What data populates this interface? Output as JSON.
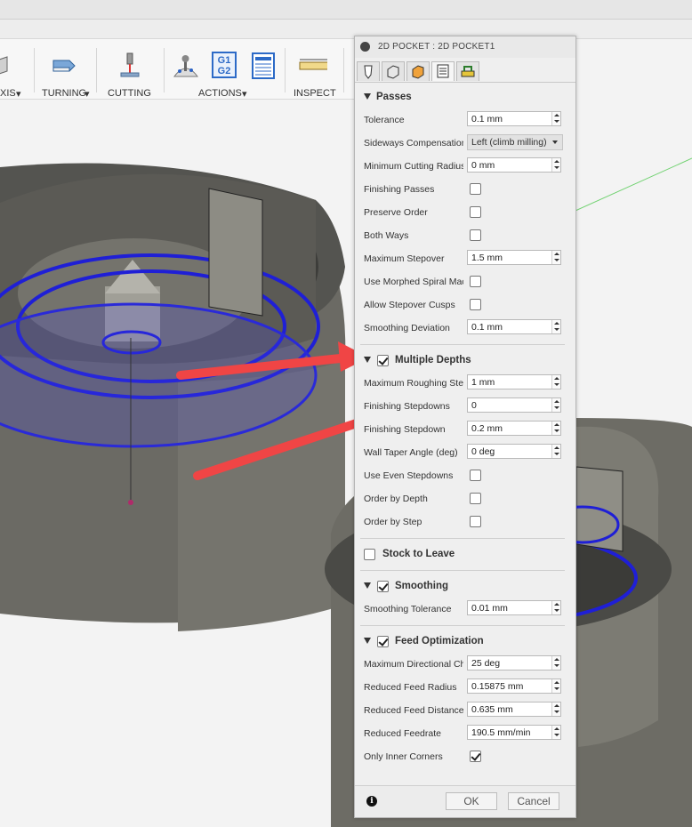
{
  "toolbar": {
    "axis_label": "XIS",
    "turning_label": "TURNING",
    "cutting_label": "CUTTING",
    "actions_label": "ACTIONS",
    "inspect_label": "INSPECT",
    "g1g2_top": "G1",
    "g1g2_bottom": "G2",
    "icons": [
      "axis-icon",
      "turning-icon",
      "cutting-icon",
      "actions-simulate-icon",
      "g1g2-icon",
      "setup-sheet-icon",
      "measure-icon"
    ]
  },
  "panel": {
    "title": "2D POCKET : 2D POCKET1",
    "tabs": [
      "tool-tab",
      "geometry-tab",
      "heights-tab",
      "passes-tab",
      "linking-tab"
    ],
    "active_tab": "passes-tab",
    "passes": {
      "title": "Passes",
      "tolerance_label": "Tolerance",
      "tolerance_value": "0.1 mm",
      "sideways_label": "Sideways Compensation",
      "sideways_value": "Left (climb milling)",
      "min_radius_label": "Minimum Cutting Radius",
      "min_radius_value": "0 mm",
      "finishing_passes_label": "Finishing Passes",
      "finishing_passes_checked": false,
      "preserve_order_label": "Preserve Order",
      "preserve_order_checked": false,
      "both_ways_label": "Both Ways",
      "both_ways_checked": false,
      "max_stepover_label": "Maximum Stepover",
      "max_stepover_value": "1.5 mm",
      "morphed_label": "Use Morphed Spiral Machining",
      "morphed_checked": false,
      "stepover_cusps_label": "Allow Stepover Cusps",
      "stepover_cusps_checked": false,
      "smoothing_dev_label": "Smoothing Deviation",
      "smoothing_dev_value": "0.1 mm"
    },
    "multiple_depths": {
      "title": "Multiple Depths",
      "checked": true,
      "max_roughing_label": "Maximum Roughing Stepdown",
      "max_roughing_value": "1 mm",
      "finishing_stepdowns_label": "Finishing Stepdowns",
      "finishing_stepdowns_value": "0",
      "finishing_stepdown_label": "Finishing Stepdown",
      "finishing_stepdown_value": "0.2 mm",
      "wall_taper_label": "Wall Taper Angle (deg)",
      "wall_taper_value": "0 deg",
      "even_stepdowns_label": "Use Even Stepdowns",
      "even_stepdowns_checked": false,
      "order_depth_label": "Order by Depth",
      "order_depth_checked": false,
      "order_step_label": "Order by Step",
      "order_step_checked": false
    },
    "stock": {
      "title": "Stock to Leave",
      "checked": false
    },
    "smoothing": {
      "title": "Smoothing",
      "checked": true,
      "tolerance_label": "Smoothing Tolerance",
      "tolerance_value": "0.01 mm"
    },
    "feed_optimization": {
      "title": "Feed Optimization",
      "checked": true,
      "max_dir_label": "Maximum Directional Change",
      "max_dir_value": "25 deg",
      "feed_radius_label": "Reduced Feed Radius",
      "feed_radius_value": "0.15875 mm",
      "feed_distance_label": "Reduced Feed Distance",
      "feed_distance_value": "0.635 mm",
      "feedrate_label": "Reduced Feedrate",
      "feedrate_value": "190.5 mm/min",
      "inner_corners_label": "Only Inner Corners",
      "inner_corners_checked": true
    },
    "ok_label": "OK",
    "cancel_label": "Cancel"
  },
  "colors": {
    "toolpath_blue": "#1f1fd6",
    "arrow_red": "#f04545",
    "part_gray": "#6b6a64"
  }
}
